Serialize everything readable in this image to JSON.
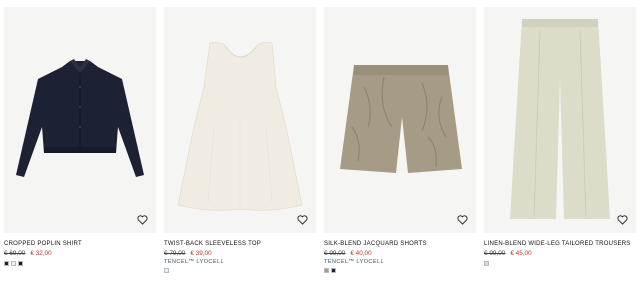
{
  "products": [
    {
      "name": "CROPPED POPLIN SHIRT",
      "old_price": "€ 69,00",
      "sale_price": "€ 32,00",
      "material": "",
      "swatches": [
        "#1c2233",
        "#f2f0ea",
        "#1a1a1a"
      ],
      "image": "cropped-navy-shirt"
    },
    {
      "name": "TWIST-BACK SLEEVELESS TOP",
      "old_price": "€ 79,00",
      "sale_price": "€ 39,00",
      "material": "TENCEL™ LYOCELL",
      "swatches": [
        "#f1ece2"
      ],
      "image": "cream-sleeveless-top"
    },
    {
      "name": "SILK-BLEND JACQUARD SHORTS",
      "old_price": "€ 99,00",
      "sale_price": "€ 40,00",
      "material": "TENCEL™ LYOCELL",
      "swatches": [
        "#a69c86",
        "#1c2233"
      ],
      "image": "jacquard-shorts"
    },
    {
      "name": "LINEN-BLEND WIDE-LEG TAILORED TROUSERS",
      "old_price": "€ 99,00",
      "sale_price": "€ 45,00",
      "material": "",
      "swatches": [
        "#dcdcc8"
      ],
      "image": "wide-leg-trousers"
    }
  ],
  "icons": {
    "wishlist": "heart-icon"
  },
  "colors": {
    "sale": "#c0392b",
    "material_link": "#3a5678",
    "image_bg": "#f5f5f4"
  }
}
